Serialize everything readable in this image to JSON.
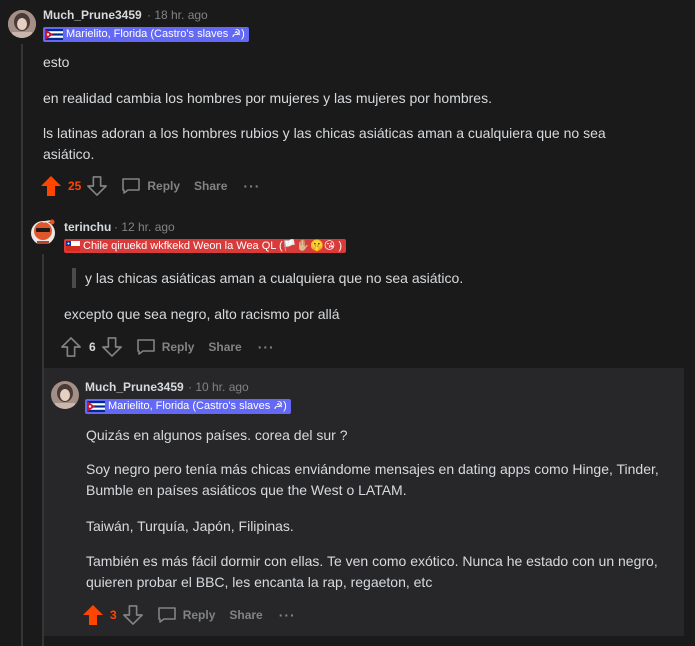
{
  "comment1": {
    "username": "Much_Prune3459",
    "meta": "· 18 hr. ago",
    "flair": "Marielito, Florida (Castro's slaves ☭)",
    "flair_bg": "#6469f5",
    "paragraphs": [
      "esto",
      "en realidad cambia los hombres por mujeres y las mujeres por hombres.",
      "ls latinas adoran a los hombres rubios y las chicas asiáticas aman a cualquiera que no sea asiático."
    ],
    "votes": "25",
    "reply_label": "Reply",
    "share_label": "Share",
    "more_label": "···"
  },
  "comment2": {
    "username": "terinchu",
    "meta": "· 12 hr. ago",
    "flair": "Chile qiruekd wkfkekd Weon la Wea QL (🏳️✋🏼🤫😘 )",
    "flair_bg": "#d93a3a",
    "quote": "y las chicas asiáticas aman a cualquiera que no sea asiático.",
    "paragraphs": [
      "excepto que sea negro, alto racismo por allá"
    ],
    "votes": "6",
    "reply_label": "Reply",
    "share_label": "Share",
    "more_label": "···"
  },
  "comment3": {
    "username": "Much_Prune3459",
    "meta": "· 10 hr. ago",
    "flair": "Marielito, Florida (Castro's slaves ☭)",
    "flair_bg": "#6469f5",
    "paragraphs": [
      "Quizás en algunos países. corea del sur ?",
      "Soy negro pero tenía más chicas enviándome mensajes en dating apps como Hinge, Tinder, Bumble en países asiáticos que the West o LATAM.",
      "Taiwán, Turquía, Japón, Filipinas.",
      "También es más fácil dormir con ellas. Te ven como exótico. Nunca he estado con un negro, quieren probar el BBC, les encanta la rap, regaeton, etc"
    ],
    "votes": "3",
    "reply_label": "Reply",
    "share_label": "Share",
    "more_label": "···"
  },
  "colors": {
    "upvote_active": "#ff4500",
    "text": "#d7dadc",
    "muted": "#818384",
    "background": "#1a1a1b"
  }
}
